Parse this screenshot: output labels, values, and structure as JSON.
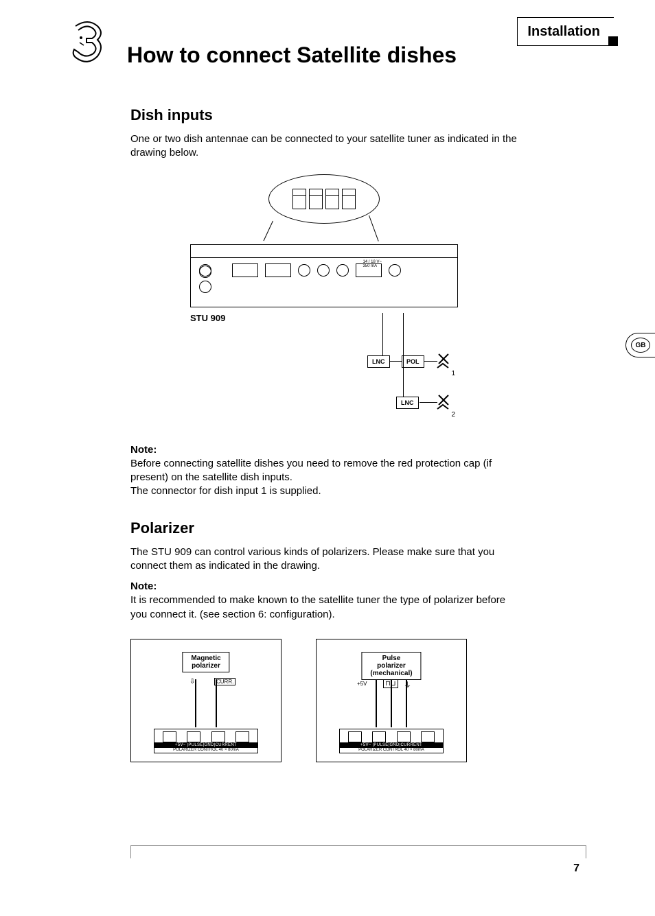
{
  "header": {
    "section_label": "Installation",
    "chapter_number": "3",
    "title": "How to connect Satellite dishes"
  },
  "section_dish": {
    "heading": "Dish inputs",
    "intro": "One or two dish antennae can be connected to your satellite tuner as indicated in the drawing below.",
    "device_label": "STU 909",
    "panel_text": "14 / 18 V~\n350 mA",
    "box_lnc": "LNC",
    "box_pol": "POL",
    "dish_sub_1": "1",
    "dish_sub_2": "2",
    "note_label": "Note:",
    "note_body": "Before connecting satellite dishes you need to remove the red protection cap (if present) on the satellite dish inputs.\nThe connector for dish input 1 is supplied."
  },
  "section_polarizer": {
    "heading": "Polarizer",
    "intro": "The STU 909 can control various kinds of polarizers. Please make sure that you connect them as indicated in the drawing.",
    "note_label": "Note:",
    "note_body": "It is recommended to make known to the satellite tuner the type of polarizer before you connect it. (see section 6: configuration).",
    "dia1_label": "Magnetic\npolarizer",
    "dia1_curr": "CURR.",
    "dia2_label": "Pulse\npolarizer\n(mechanical)",
    "dia2_plus5v": "+5V",
    "terminal_strip": "+5V~ |PULSE|GND|CURRENT",
    "terminal_sub": "POLARIZER CONTROL 40 × 80mA"
  },
  "side_tab": "GB",
  "page_number": "7"
}
